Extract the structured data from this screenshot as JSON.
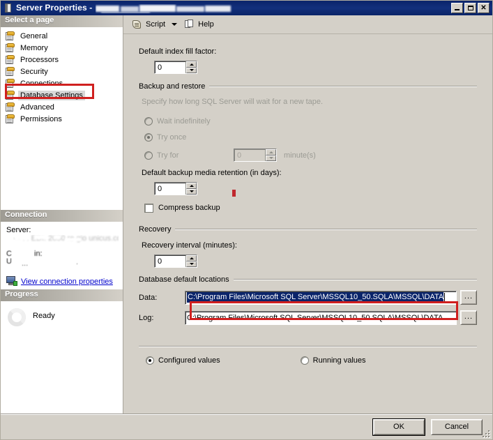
{
  "window": {
    "title_prefix": "Server Properties - ",
    "title_redacted": true,
    "minimize_label": "",
    "maximize_label": "",
    "close_label": "✕"
  },
  "toolbar": {
    "script_label": "Script",
    "help_label": "Help"
  },
  "sidebar": {
    "select_a_page_header": "Select a page",
    "items": [
      {
        "label": "General"
      },
      {
        "label": "Memory"
      },
      {
        "label": "Processors"
      },
      {
        "label": "Security"
      },
      {
        "label": "Connections"
      },
      {
        "label": "Database Settings"
      },
      {
        "label": "Advanced"
      },
      {
        "label": "Permissions"
      }
    ],
    "selected_index": 5,
    "connection": {
      "header": "Connection",
      "server_label": "Server:",
      "server_value": "",
      "connection_label": "Connection:",
      "connection_value": "",
      "view_properties_link": "View connection properties"
    },
    "progress": {
      "header": "Progress",
      "status": "Ready"
    }
  },
  "main": {
    "fill_factor_label": "Default index fill factor:",
    "fill_factor_value": "0",
    "backup_group": "Backup and restore",
    "backup_hint": "Specify how long SQL Server will wait for a new tape.",
    "wait_indefinitely_label": "Wait indefinitely",
    "try_once_label": "Try once",
    "try_for_label": "Try for",
    "try_for_value": "0",
    "minutes_label": "minute(s)",
    "retention_label": "Default backup media retention (in days):",
    "retention_value": "0",
    "compress_backup_label": "Compress backup",
    "recovery_group": "Recovery",
    "recovery_interval_label": "Recovery interval (minutes):",
    "recovery_interval_value": "0",
    "db_locations_group": "Database default locations",
    "data_label": "Data:",
    "data_path": "C:\\Program Files\\Microsoft SQL Server\\MSSQL10_50.SQLA\\MSSQL\\DATA",
    "log_label": "Log:",
    "log_path": "C:\\Program Files\\Microsoft SQL Server\\MSSQL10_50.SQLA\\MSSQL\\DATA",
    "browse_label": "...",
    "configured_values_label": "Configured values",
    "running_values_label": "Running values"
  },
  "footer": {
    "ok_label": "OK",
    "cancel_label": "Cancel"
  },
  "annotations": {
    "color": "#d0201f",
    "boxes": [
      "database-settings-page-item",
      "data-path-field"
    ],
    "dot": true
  }
}
